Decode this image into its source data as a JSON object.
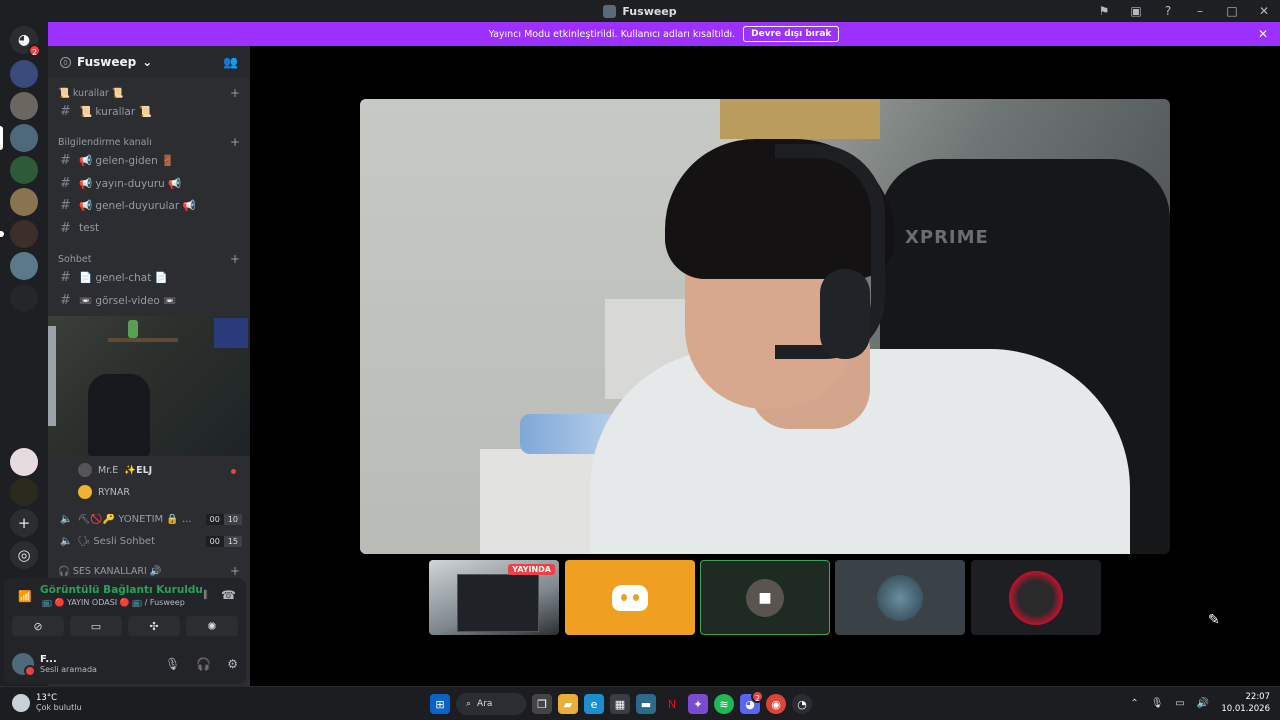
{
  "window": {
    "title": "Fusweep",
    "controls": [
      "flag-icon",
      "inbox-icon",
      "help-icon",
      "minimize-icon",
      "maximize-icon",
      "close-icon"
    ]
  },
  "rail": {
    "home_badge": "2"
  },
  "banner": {
    "message": "Yayıncı Modu etkinleştirildi. Kullanıcı adları kısaltıldı.",
    "action_label": "Devre dışı bırak"
  },
  "server": {
    "name": "Fusweep",
    "categories": [
      {
        "label": "📜 kurallar 📜",
        "channels": [
          {
            "name": "📜 kurallar 📜"
          }
        ]
      },
      {
        "label": "Bilgilendirme kanalı",
        "channels": [
          {
            "name": "📢 gelen-giden 🚪"
          },
          {
            "name": "📢 yayın-duyuru 📢"
          },
          {
            "name": "📢 genel-duyurular 📢"
          },
          {
            "name": "test"
          }
        ]
      },
      {
        "label": "Sohbet",
        "channels": [
          {
            "name": "📄 genel-chat 📄"
          },
          {
            "name": "📼 görsel-video 📼"
          }
        ]
      }
    ],
    "voice_members": [
      {
        "name": "Mr.E",
        "tag": "✨ELJ"
      },
      {
        "name": "RYNAR",
        "tag": ""
      }
    ],
    "voice_channels": [
      {
        "label": "⛏🚫🔑 YÖNETİM 🔒 ...",
        "count_a": "00",
        "count_b": "10"
      },
      {
        "label": "🗣 Sesli Sohbet",
        "count_a": "00",
        "count_b": "15"
      }
    ],
    "voice_category": "🎧 SES KANALLARI 🔊"
  },
  "voice_panel": {
    "status": "Görüntülü Bağlantı Kuruldu",
    "sub": "📺 🔴 YAYIN ODASI 🔴 📺 / Fusweep"
  },
  "user": {
    "name": "F...",
    "status": "Sesli aramada"
  },
  "stage": {
    "chair_brand": "XPRIME",
    "live_label": "YAYINDA"
  },
  "taskbar": {
    "temperature": "13°C",
    "weather": "Çok bulutlu",
    "search_label": "Ara",
    "time": "22:07",
    "date": "10.01.2026",
    "discord_badge": "2"
  }
}
